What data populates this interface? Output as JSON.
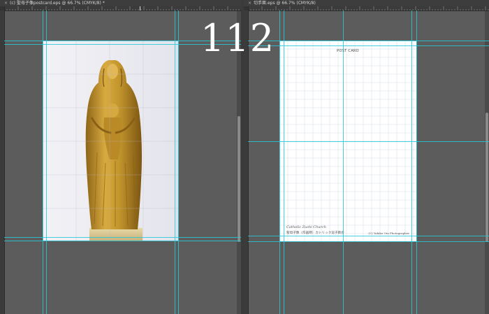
{
  "left_panel": {
    "tab_title": "(c) 聖母子像postcard.eps @ 66.7% (CMYK/8) *",
    "close": "×"
  },
  "right_panel": {
    "tab_title": "切手面.eps @ 66.7% (CMYK/8)",
    "close": "×"
  },
  "page_number": "112",
  "postcard": {
    "title": "POST CARD",
    "church_name": "Catholic Zushi Church",
    "japanese_text": "聖母子像（作画時）カトリック逗子教会",
    "copyright": "(C) Yukiko Ota Photographer"
  },
  "colors": {
    "workspace": "#5c5c5c",
    "guide": "#27c9d9",
    "statue_gold": "#c89a2c",
    "paper": "#ffffff"
  }
}
